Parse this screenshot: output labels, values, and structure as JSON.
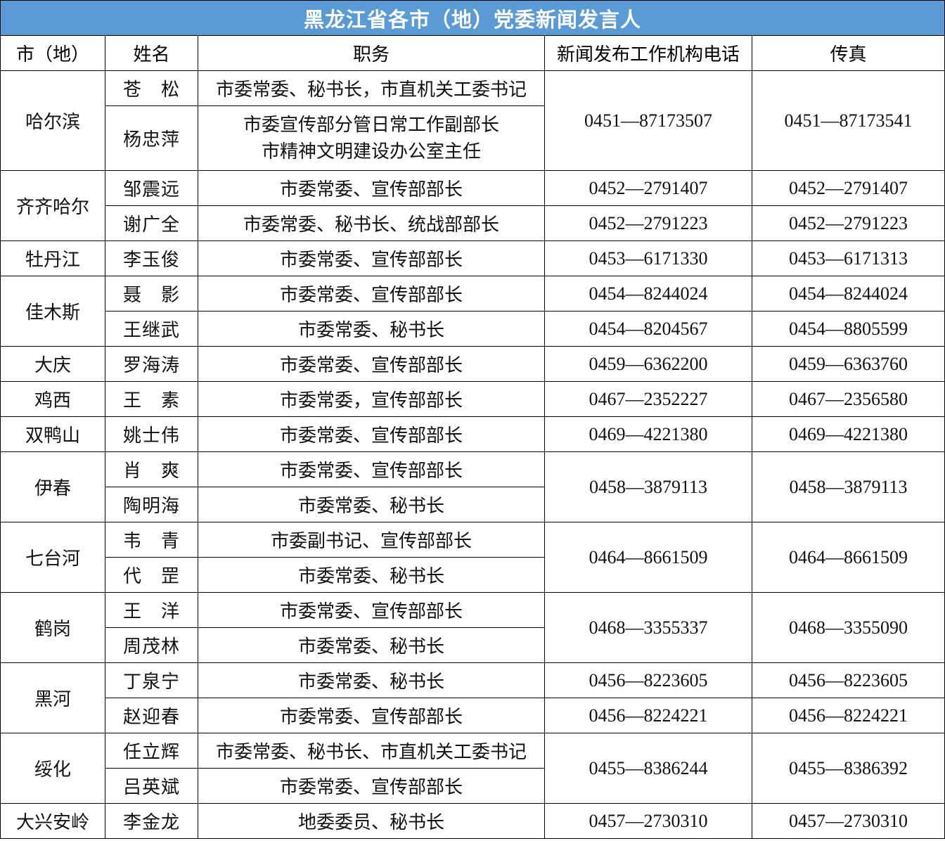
{
  "title": "黑龙江省各市（地）党委新闻发言人",
  "headers": [
    "市（地）",
    "姓名",
    "职务",
    "新闻发布工作机构电话",
    "传真"
  ],
  "rows": [
    {
      "city": "哈尔滨",
      "name": "苍　松",
      "position": "市委常委、秘书长，市直机关工委书记",
      "phone": "0451—87173507",
      "fax": "0451—87173541"
    },
    {
      "name": "杨忠萍",
      "position_line1": "市委宣传部分管日常工作副部长",
      "position_line2": "市精神文明建设办公室主任"
    },
    {
      "city": "齐齐哈尔",
      "name": "邹震远",
      "position": "市委常委、宣传部部长",
      "phone": "0452—2791407",
      "fax": "0452—2791407"
    },
    {
      "name": "谢广全",
      "position": "市委常委、秘书长、统战部部长",
      "phone": "0452—2791223",
      "fax": "0452—2791223"
    },
    {
      "city": "牡丹江",
      "name": "李玉俊",
      "position": "市委常委、宣传部部长",
      "phone": "0453—6171330",
      "fax": "0453—6171313"
    },
    {
      "city": "佳木斯",
      "name": "聂　影",
      "position": "市委常委、宣传部部长",
      "phone": "0454—8244024",
      "fax": "0454—8244024"
    },
    {
      "name": "王继武",
      "position": "市委常委、秘书长",
      "phone": "0454—8204567",
      "fax": "0454—8805599"
    },
    {
      "city": "大庆",
      "name": "罗海涛",
      "position": "市委常委、宣传部部长",
      "phone": "0459—6362200",
      "fax": "0459—6363760"
    },
    {
      "city": "鸡西",
      "name": "王　素",
      "position": "市委常委，宣传部部长",
      "phone": "0467—2352227",
      "fax": "0467—2356580"
    },
    {
      "city": "双鸭山",
      "name": "姚士伟",
      "position": "市委常委、宣传部部长",
      "phone": "0469—4221380",
      "fax": "0469—4221380"
    },
    {
      "city": "伊春",
      "name": "肖　爽",
      "position": "市委常委、宣传部部长",
      "phone": "0458—3879113",
      "fax": "0458—3879113"
    },
    {
      "name": "陶明海",
      "position": "市委常委、秘书长"
    },
    {
      "city": "七台河",
      "name": "韦　青",
      "position": "市委副书记、宣传部部长",
      "phone": "0464—8661509",
      "fax": "0464—8661509"
    },
    {
      "name": "代　罡",
      "position": "市委常委、秘书长"
    },
    {
      "city": "鹤岗",
      "name": "王　洋",
      "position": "市委常委、宣传部部长",
      "phone": "0468—3355337",
      "fax": "0468—3355090"
    },
    {
      "name": "周茂林",
      "position": "市委常委、秘书长"
    },
    {
      "city": "黑河",
      "name": "丁泉宁",
      "position": "市委常委、秘书长",
      "phone": "0456—8223605",
      "fax": "0456—8223605"
    },
    {
      "name": "赵迎春",
      "position": "市委常委、宣传部部长",
      "phone": "0456—8224221",
      "fax": "0456—8224221"
    },
    {
      "city": "绥化",
      "name": "任立辉",
      "position": "市委常委、秘书长、市直机关工委书记",
      "phone": "0455—8386244",
      "fax": "0455—8386392"
    },
    {
      "name": "吕英斌",
      "position": "市委常委、宣传部部长"
    },
    {
      "city": "大兴安岭",
      "name": "李金龙",
      "position": "地委委员、秘书长",
      "phone": "0457—2730310",
      "fax": "0457—2730310"
    }
  ]
}
